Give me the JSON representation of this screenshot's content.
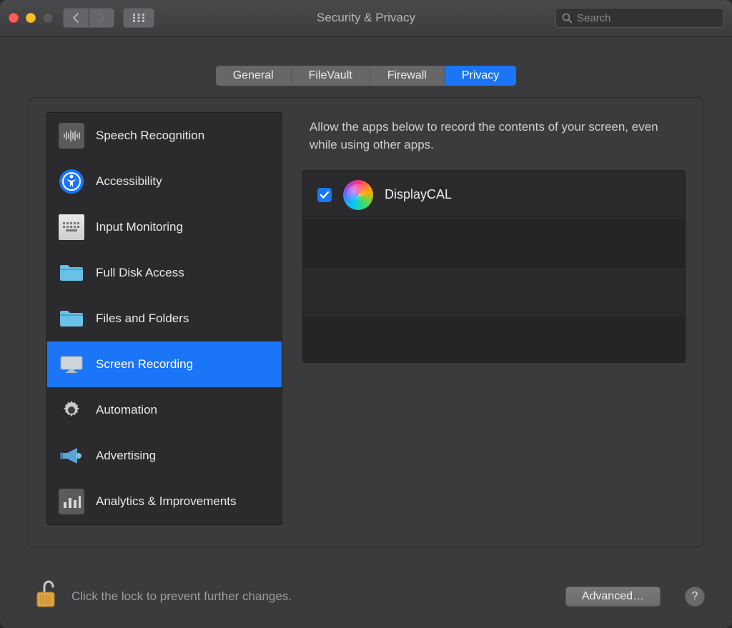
{
  "window": {
    "title": "Security & Privacy"
  },
  "search": {
    "placeholder": "Search"
  },
  "tabs": [
    {
      "label": "General",
      "active": false
    },
    {
      "label": "FileVault",
      "active": false
    },
    {
      "label": "Firewall",
      "active": false
    },
    {
      "label": "Privacy",
      "active": true
    }
  ],
  "sidebar": {
    "items": [
      {
        "label": "Speech Recognition",
        "icon": "waveform-icon"
      },
      {
        "label": "Accessibility",
        "icon": "accessibility-icon"
      },
      {
        "label": "Input Monitoring",
        "icon": "keyboard-icon"
      },
      {
        "label": "Full Disk Access",
        "icon": "folder-icon"
      },
      {
        "label": "Files and Folders",
        "icon": "folder-icon"
      },
      {
        "label": "Screen Recording",
        "icon": "display-icon",
        "selected": true
      },
      {
        "label": "Automation",
        "icon": "gear-icon"
      },
      {
        "label": "Advertising",
        "icon": "megaphone-icon"
      },
      {
        "label": "Analytics & Improvements",
        "icon": "bars-icon"
      }
    ]
  },
  "main": {
    "description": "Allow the apps below to record the contents of your screen, even while using other apps.",
    "apps": [
      {
        "name": "DisplayCAL",
        "checked": true
      }
    ]
  },
  "footer": {
    "lock_text": "Click the lock to prevent further changes.",
    "advanced_label": "Advanced…",
    "help_label": "?"
  }
}
